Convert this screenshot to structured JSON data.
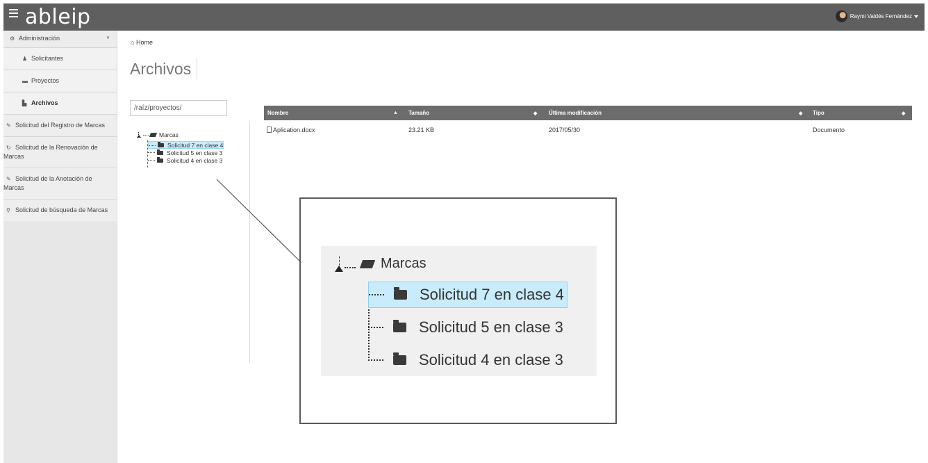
{
  "header": {
    "logo": "ableip",
    "user_name": "Raymi Valdés Fernández"
  },
  "sidebar": {
    "admin_label": "Administración",
    "sub_items": [
      {
        "label": "Solicitantes",
        "icon": "user-icon"
      },
      {
        "label": "Proyectos",
        "icon": "briefcase-icon"
      },
      {
        "label": "Archivos",
        "icon": "file-icon",
        "active": true
      }
    ],
    "items": [
      {
        "label": "Solicitud del Registro de Marcas",
        "icon": "edit-icon"
      },
      {
        "label": "Solicitud de la Renovación de Marcas",
        "icon": "refresh-icon"
      },
      {
        "label": "Solicitud de la Anotación de Marcas",
        "icon": "paperclip-icon"
      },
      {
        "label": "Solicitud de búsqueda de Marcas",
        "icon": "search-icon"
      }
    ]
  },
  "breadcrumb": {
    "home": "Home"
  },
  "page_title": "Archivos",
  "path_input": {
    "value": "/raíz/proyectos/"
  },
  "tree": {
    "root": "Marcas",
    "children": [
      {
        "label": "Solicitud 7 en clase 4",
        "selected": true
      },
      {
        "label": "Solicitud 5 en clase 3",
        "selected": false
      },
      {
        "label": "Solicitud 4 en clase 3",
        "selected": false
      }
    ]
  },
  "table": {
    "columns": [
      "Nombre",
      "Tamaño",
      "Última modificación",
      "Tipo"
    ],
    "rows": [
      {
        "name": "Aplication.docx",
        "size": "23.21 KB",
        "modified": "2017/05/30",
        "type": "Documento"
      }
    ]
  },
  "colors": {
    "topbar": "#5f5f5f",
    "selected": "#c8ecfb",
    "table_header": "#6c6c6c"
  }
}
